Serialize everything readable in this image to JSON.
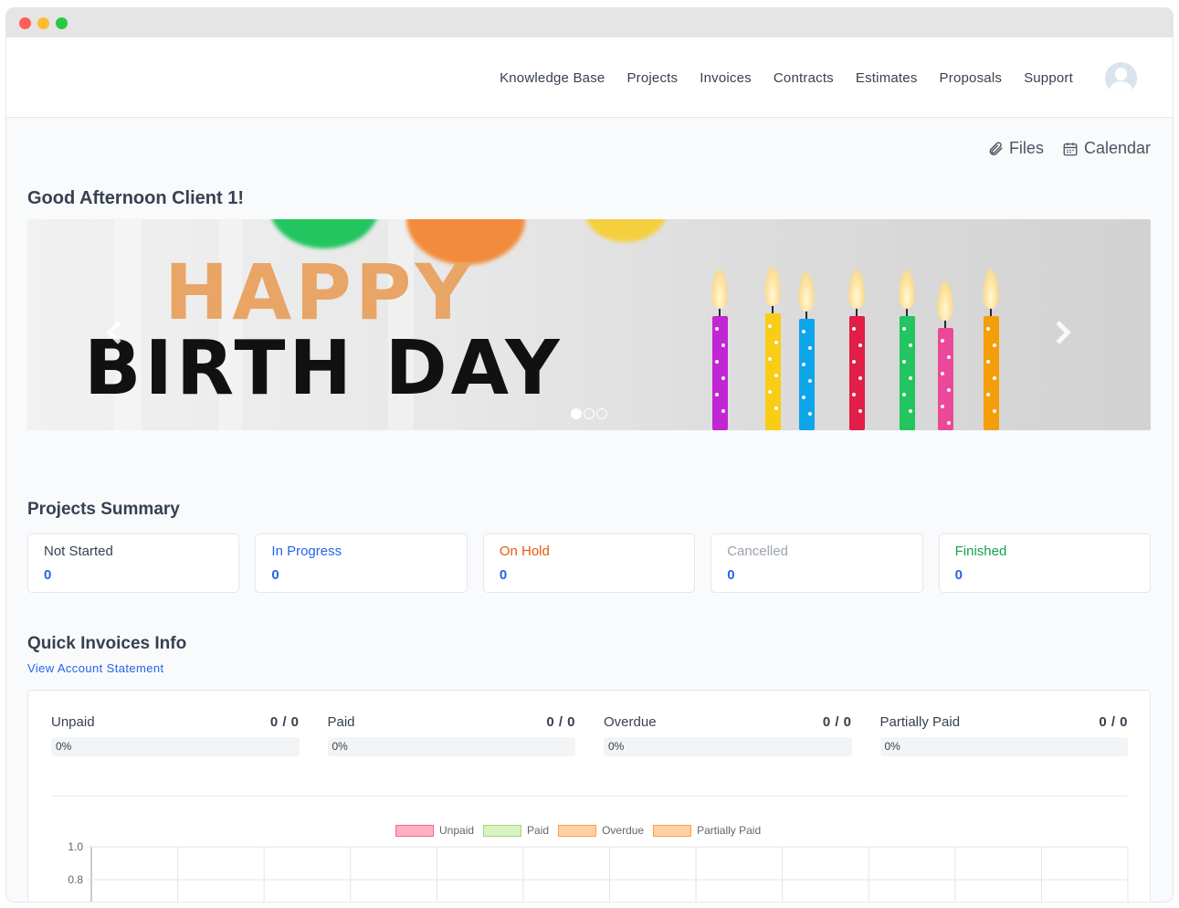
{
  "nav": {
    "links": [
      "Knowledge Base",
      "Projects",
      "Invoices",
      "Contracts",
      "Estimates",
      "Proposals",
      "Support"
    ]
  },
  "toplinks": {
    "files": "Files",
    "calendar": "Calendar"
  },
  "greeting": "Good Afternoon Client 1!",
  "banner": {
    "line1": "HAPPY",
    "line2": "BIRTH DAY",
    "slides": 3,
    "active_slide": 1
  },
  "projects_summary": {
    "title": "Projects Summary",
    "cards": [
      {
        "label": "Not Started",
        "count": "0",
        "color": "#374151"
      },
      {
        "label": "In Progress",
        "count": "0",
        "color": "#2563eb"
      },
      {
        "label": "On Hold",
        "count": "0",
        "color": "#ea580c"
      },
      {
        "label": "Cancelled",
        "count": "0",
        "color": "#9ca3af"
      },
      {
        "label": "Finished",
        "count": "0",
        "color": "#16a34a"
      }
    ]
  },
  "invoices": {
    "title": "Quick Invoices Info",
    "statement_link": "View Account Statement",
    "items": [
      {
        "label": "Unpaid",
        "fraction": "0 / 0",
        "percent": "0%",
        "progress": 0
      },
      {
        "label": "Paid",
        "fraction": "0 / 0",
        "percent": "0%",
        "progress": 0
      },
      {
        "label": "Overdue",
        "fraction": "0 / 0",
        "percent": "0%",
        "progress": 0
      },
      {
        "label": "Partially Paid",
        "fraction": "0 / 0",
        "percent": "0%",
        "progress": 0
      }
    ]
  },
  "chart_data": {
    "type": "bar",
    "series": [
      {
        "name": "Unpaid",
        "fill": "#ffb1c1",
        "stroke": "#ff6384",
        "values": []
      },
      {
        "name": "Paid",
        "fill": "#d9f2c2",
        "stroke": "#a3d977",
        "values": []
      },
      {
        "name": "Overdue",
        "fill": "#ffd0a6",
        "stroke": "#ff9f40",
        "values": []
      },
      {
        "name": "Partially Paid",
        "fill": "#ffd0a6",
        "stroke": "#ff9f40",
        "values": []
      }
    ],
    "y_ticks": [
      "1.0",
      "0.8"
    ],
    "ylim": [
      0,
      1.0
    ],
    "grid": true,
    "legend": "top"
  }
}
